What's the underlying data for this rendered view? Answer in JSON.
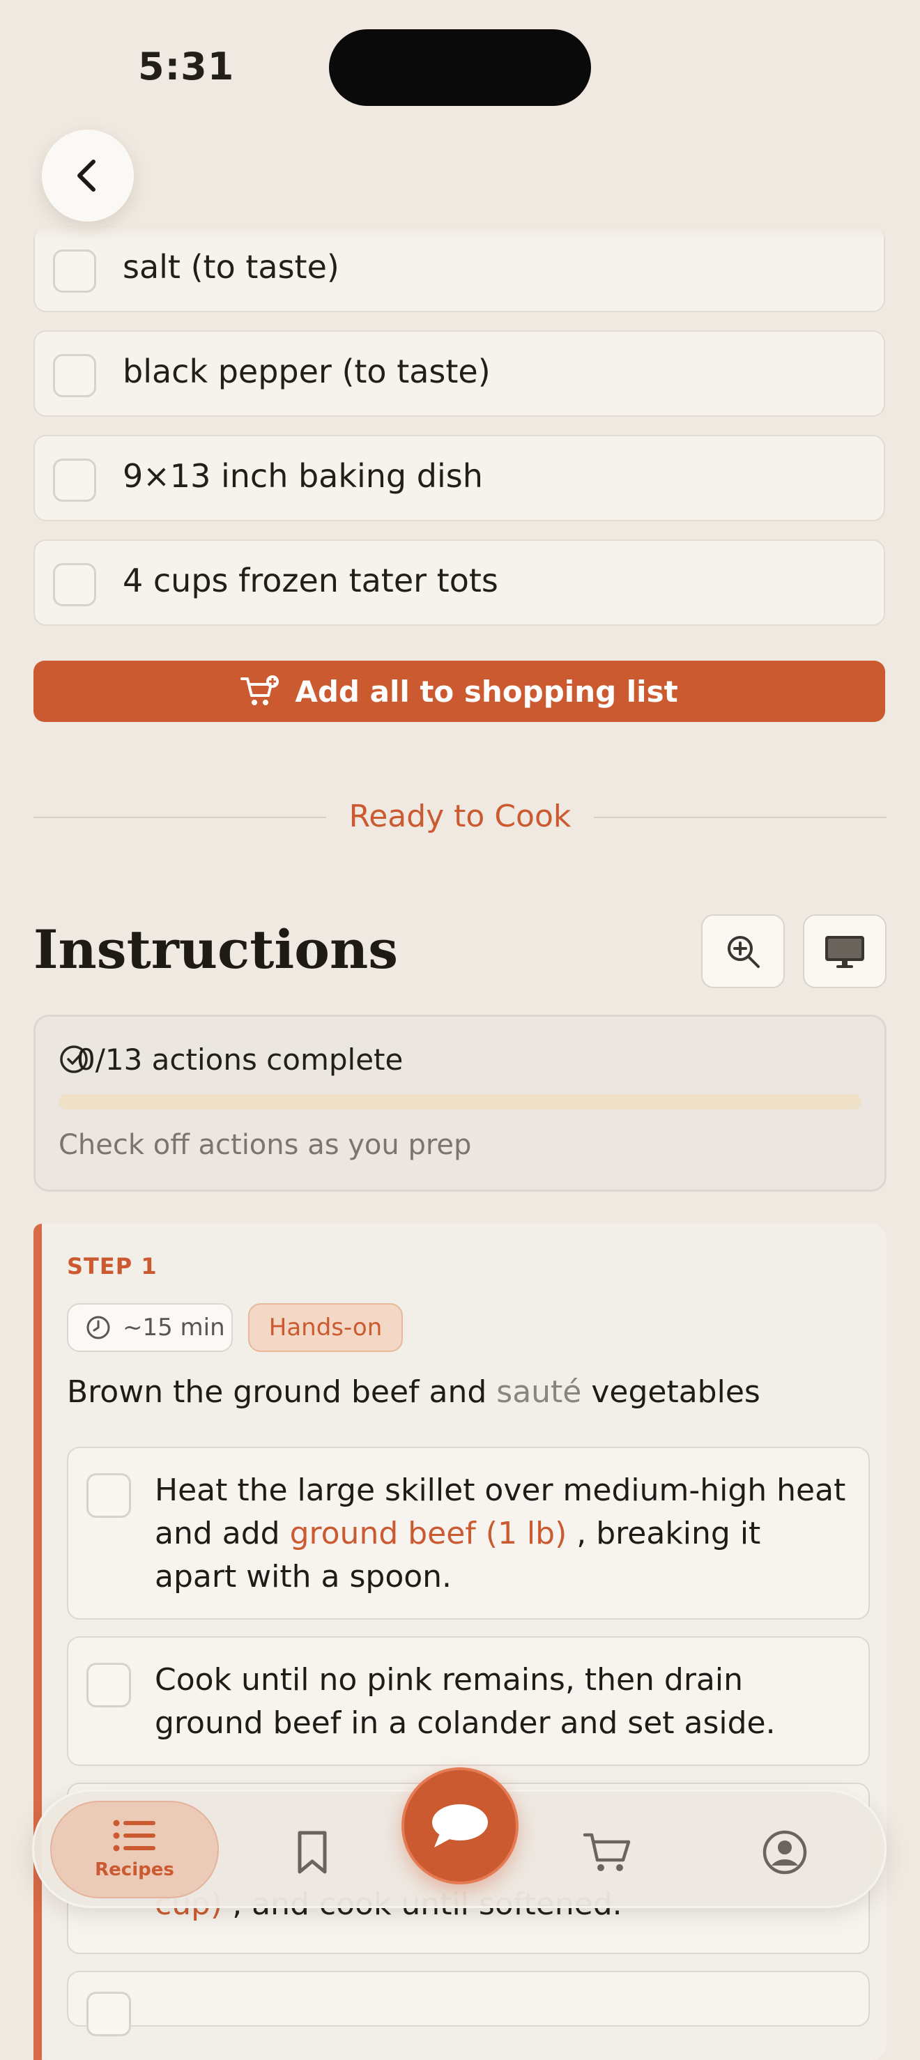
{
  "status_bar": {
    "time": "5:31"
  },
  "ingredients": [
    "salt (to taste)",
    "black pepper (to taste)",
    "9×13 inch baking dish",
    "4 cups frozen tater tots"
  ],
  "add_all_label": "Add all to shopping list",
  "ready_label": "Ready to Cook",
  "instructions": {
    "title": "Instructions",
    "progress_label": "0/13 actions complete",
    "progress_fraction": 0,
    "progress_hint": "Check off actions as you prep"
  },
  "step": {
    "label": "STEP 1",
    "time": "~15 min",
    "tag": "Hands-on",
    "title_a": "Brown the ground beef and ",
    "title_muted": "sauté",
    "title_b": " vegetables",
    "actions": [
      {
        "line1": "Heat the large skillet over medium-high heat",
        "pre": "and add ",
        "highlight": "ground beef (1 lb)",
        "post": ", breaking it",
        "line3": "apart with a spoon."
      },
      {
        "line1": "Cook until no pink remains, then drain",
        "line2": "ground beef in a colander and set aside."
      },
      {
        "highlight": "cup)",
        "post": ", and cook until softened."
      }
    ]
  },
  "nav": {
    "recipes_label": "Recipes",
    "icons": [
      "list-icon",
      "bookmark-icon",
      "chat-icon",
      "cart-icon",
      "profile-icon"
    ]
  },
  "colors": {
    "accent": "#cc5a30",
    "background": "#efe9e1"
  }
}
